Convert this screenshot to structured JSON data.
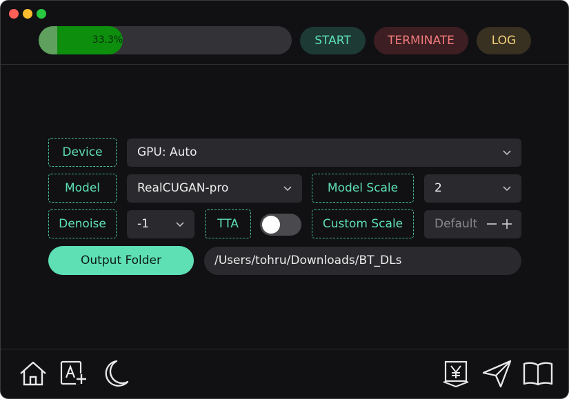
{
  "window": {
    "controls": [
      "close",
      "minimize",
      "zoom"
    ]
  },
  "toolbar": {
    "progress_percent": 33.3,
    "progress_label": "33.3%",
    "start_label": "START",
    "terminate_label": "TERMINATE",
    "log_label": "LOG"
  },
  "settings": {
    "device_label": "Device",
    "device_value": "GPU: Auto",
    "model_label": "Model",
    "model_value": "RealCUGAN-pro",
    "model_scale_label": "Model Scale",
    "model_scale_value": "2",
    "denoise_label": "Denoise",
    "denoise_value": "-1",
    "tta_label": "TTA",
    "tta_enabled": false,
    "custom_scale_label": "Custom Scale",
    "custom_scale_placeholder": "Default",
    "output_folder_label": "Output Folder",
    "output_folder_path": "/Users/tohru/Downloads/BT_DLs"
  },
  "bottom_bar": {
    "left_icons": [
      "home-icon",
      "translate-icon",
      "moon-icon"
    ],
    "right_icons": [
      "yen-icon",
      "send-icon",
      "book-icon"
    ]
  },
  "colors": {
    "accent": "#5ee0b4",
    "background": "#111114",
    "progress_fill": "#0d8f0d",
    "start_text": "#5ee0b4",
    "terminate_text": "#ef7b7b",
    "log_text": "#f2d07a"
  }
}
